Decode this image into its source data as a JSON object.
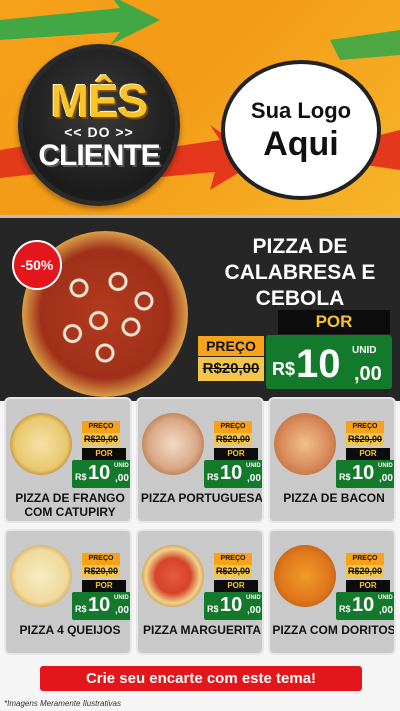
{
  "badge": {
    "line1": "MÊS",
    "line2": "<< DO >>",
    "line3": "CLIENTE"
  },
  "logo": {
    "line1": "Sua Logo",
    "line2": "Aqui"
  },
  "featured": {
    "discount": "-50%",
    "title": "PIZZA DE CALABRESA E CEBOLA",
    "preco_label": "PREÇO",
    "old_price": "R$20,00",
    "por_label": "POR",
    "currency": "R$",
    "price_int": "10",
    "price_dec": ",00",
    "unit": "UNID"
  },
  "items": [
    {
      "name": "PIZZA DE FRANGO COM CATUPIRY",
      "preco_label": "PREÇO",
      "old_price": "R$20,00",
      "por_label": "POR",
      "currency": "R$",
      "price_int": "10",
      "price_dec": ",00",
      "unit": "UNID"
    },
    {
      "name": "PIZZA PORTUGUESA",
      "preco_label": "PREÇO",
      "old_price": "R$20,00",
      "por_label": "POR",
      "currency": "R$",
      "price_int": "10",
      "price_dec": ",00",
      "unit": "UNID"
    },
    {
      "name": "PIZZA DE BACON",
      "preco_label": "PREÇO",
      "old_price": "R$20,00",
      "por_label": "POR",
      "currency": "R$",
      "price_int": "10",
      "price_dec": ",00",
      "unit": "UNID"
    },
    {
      "name": "PIZZA 4 QUEIJOS",
      "preco_label": "PREÇO",
      "old_price": "R$20,00",
      "por_label": "POR",
      "currency": "R$",
      "price_int": "10",
      "price_dec": ",00",
      "unit": "UNID"
    },
    {
      "name": "PIZZA MARGUERITA",
      "preco_label": "PREÇO",
      "old_price": "R$20,00",
      "por_label": "POR",
      "currency": "R$",
      "price_int": "10",
      "price_dec": ",00",
      "unit": "UNID"
    },
    {
      "name": "PIZZA COM DORITOS",
      "preco_label": "PREÇO",
      "old_price": "R$20,00",
      "por_label": "POR",
      "currency": "R$",
      "price_int": "10",
      "price_dec": ",00",
      "unit": "UNID"
    }
  ],
  "cta": "Crie seu encarte com este tema!",
  "disclaimer": "*Imagens Meramente Ilustrativas",
  "colors": {
    "accent_orange": "#f7a21b",
    "price_green": "#127a2a",
    "discount_red": "#e3161b",
    "panel_dark": "#262626"
  }
}
